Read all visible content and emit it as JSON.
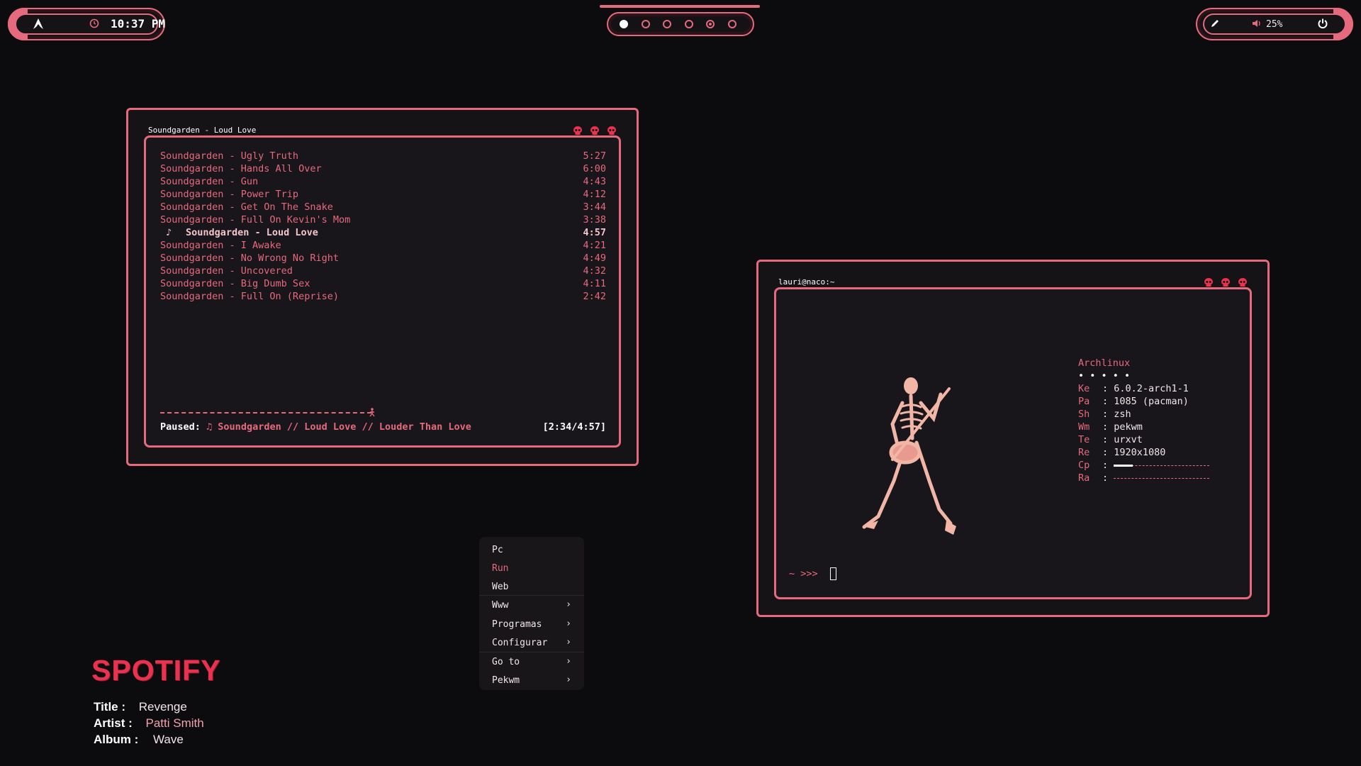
{
  "topbar": {
    "clock": "10:37 PM",
    "volume": "25%",
    "workspaces": [
      {
        "state": "active"
      },
      {
        "state": "empty"
      },
      {
        "state": "empty"
      },
      {
        "state": "empty"
      },
      {
        "state": "current"
      },
      {
        "state": "empty"
      }
    ],
    "icons": {
      "left": "arch-logo-icon",
      "clock": "clock-icon",
      "pen": "pen-icon",
      "volume": "speaker-icon",
      "power": "power-icon"
    }
  },
  "music": {
    "title": "Soundgarden - Loud Love",
    "tracks": [
      {
        "name": "Soundgarden - Ugly Truth",
        "duration": "5:27"
      },
      {
        "name": "Soundgarden - Hands All Over",
        "duration": "6:00"
      },
      {
        "name": "Soundgarden - Gun",
        "duration": "4:43"
      },
      {
        "name": "Soundgarden - Power Trip",
        "duration": "4:12"
      },
      {
        "name": "Soundgarden - Get On The Snake",
        "duration": "3:44"
      },
      {
        "name": "Soundgarden - Full On Kevin's Mom",
        "duration": "3:38"
      },
      {
        "name": "Soundgarden - Loud Love",
        "duration": "4:57",
        "current": true
      },
      {
        "name": "Soundgarden - I Awake",
        "duration": "4:21"
      },
      {
        "name": "Soundgarden - No Wrong No Right",
        "duration": "4:49"
      },
      {
        "name": "Soundgarden - Uncovered",
        "duration": "4:32"
      },
      {
        "name": "Soundgarden - Big Dumb Sex",
        "duration": "4:11"
      },
      {
        "name": "Soundgarden - Full On (Reprise)",
        "duration": "2:42"
      }
    ],
    "progress_fraction": 0.47,
    "status_label": "Paused:",
    "status_text": "♫ Soundgarden // Loud Love // Louder Than Love",
    "status_time": "[2:34/4:57]"
  },
  "terminal": {
    "title": "lauri@naco:~",
    "distro": "Archlinux",
    "dots": "• • • • •",
    "info": [
      {
        "key": "Ke",
        "value": ": 6.0.2-arch1-1"
      },
      {
        "key": "Pa",
        "value": ": 1085 (pacman)"
      },
      {
        "key": "Sh",
        "value": ": zsh"
      },
      {
        "key": "Wm",
        "value": ": pekwm"
      },
      {
        "key": "Te",
        "value": ": urxvt"
      },
      {
        "key": "Re",
        "value": ": 1920x1080"
      }
    ],
    "cpu_key": "Cp",
    "ram_key": "Ra",
    "cpu_fraction": 0.2,
    "ram_fraction": 0.0,
    "prompt": "~ >>>",
    "accent": "#e66a7e"
  },
  "menu": {
    "items": [
      {
        "label": "Pc",
        "submenu": false
      },
      {
        "label": "Run",
        "submenu": false,
        "highlight": true
      },
      {
        "label": "Web",
        "submenu": false
      },
      {
        "label": "Www",
        "submenu": true
      },
      {
        "label": "Programas",
        "submenu": true
      },
      {
        "label": "Configurar",
        "submenu": true
      },
      {
        "label": "Go to",
        "submenu": true
      },
      {
        "label": "Pekwm",
        "submenu": true
      }
    ],
    "arrow": "›"
  },
  "spotify": {
    "logo": "SPOTIFY",
    "title_label": "Title :",
    "title": "Revenge",
    "artist_label": "Artist :",
    "artist": "Patti Smith",
    "album_label": "Album :",
    "album": "Wave"
  }
}
